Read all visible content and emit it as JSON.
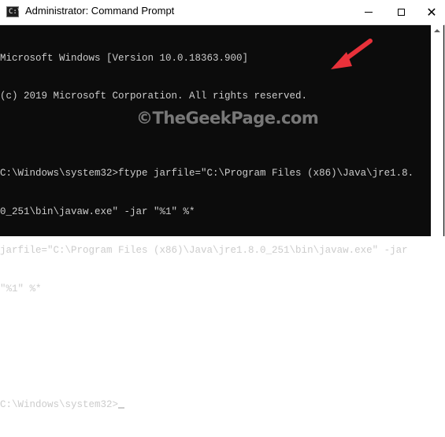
{
  "window": {
    "title": "Administrator: Command Prompt",
    "icon": "cmd-icon",
    "controls": {
      "minimize_icon": "minimize-icon",
      "maximize_icon": "maximize-icon",
      "close_icon": "close-icon"
    }
  },
  "console": {
    "lines": [
      "Microsoft Windows [Version 10.0.18363.900]",
      "(c) 2019 Microsoft Corporation. All rights reserved.",
      "",
      "C:\\Windows\\system32>ftype jarfile=\"C:\\Program Files (x86)\\Java\\jre1.8.",
      "0_251\\bin\\javaw.exe\" -jar \"%1\" %*",
      "jarfile=\"C:\\Program Files (x86)\\Java\\jre1.8.0_251\\bin\\javaw.exe\" -jar",
      "\"%1\" %*",
      "",
      "",
      "C:\\Windows\\system32>"
    ],
    "text_color": "#cccccc",
    "background": "#0c0c0c"
  },
  "watermark": "©TheGeekPage.com",
  "annotation": {
    "arrow_color": "#e8313a"
  }
}
